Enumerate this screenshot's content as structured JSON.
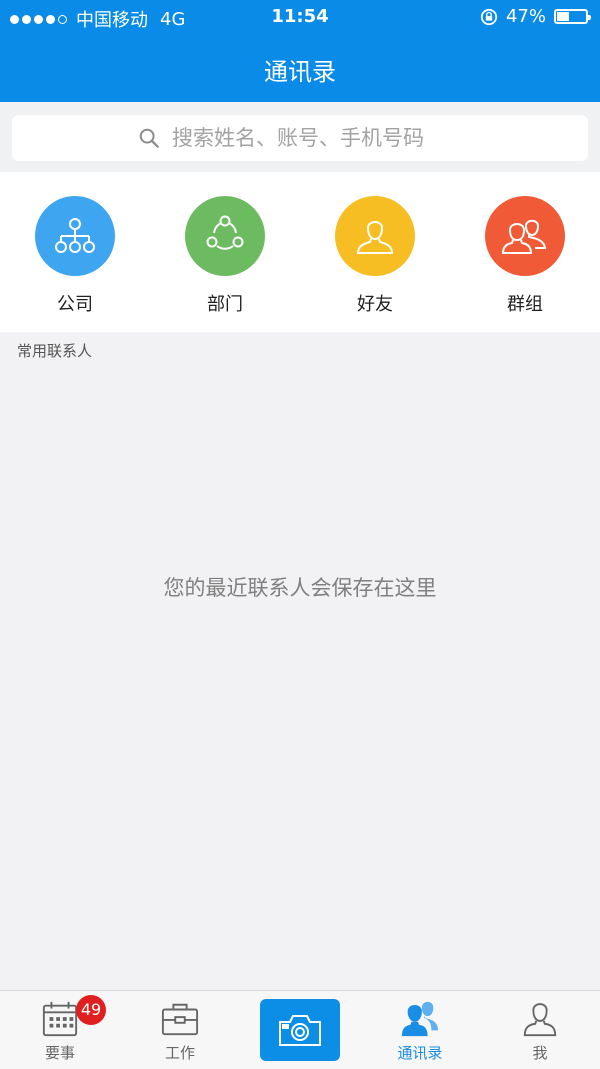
{
  "status_bar": {
    "carrier": "中国移动",
    "network": "4G",
    "time": "11:54",
    "battery_percent": "47%",
    "battery_level": 0.47,
    "signal_bars_filled": 4,
    "signal_bars_total": 5
  },
  "header": {
    "title": "通讯录",
    "background_color": "#0b8be8"
  },
  "search": {
    "placeholder": "搜索姓名、账号、手机号码",
    "value": ""
  },
  "categories": [
    {
      "label": "公司",
      "icon": "org-chart-icon",
      "color": "#3ea6f1"
    },
    {
      "label": "部门",
      "icon": "department-share-icon",
      "color": "#6cbb60"
    },
    {
      "label": "好友",
      "icon": "person-icon",
      "color": "#f6be22"
    },
    {
      "label": "群组",
      "icon": "group-icon",
      "color": "#f15a36"
    }
  ],
  "frequent_contacts": {
    "section_label": "常用联系人",
    "empty_message": "您的最近联系人会保存在这里"
  },
  "tabbar": {
    "tabs": [
      {
        "label": "要事",
        "icon": "calendar-icon",
        "badge": "49"
      },
      {
        "label": "工作",
        "icon": "briefcase-icon"
      },
      {
        "label": "",
        "icon": "camera-icon"
      },
      {
        "label": "通讯录",
        "icon": "contacts-icon",
        "active": true
      },
      {
        "label": "我",
        "icon": "profile-icon"
      }
    ],
    "active_color": "#1a8de4"
  }
}
